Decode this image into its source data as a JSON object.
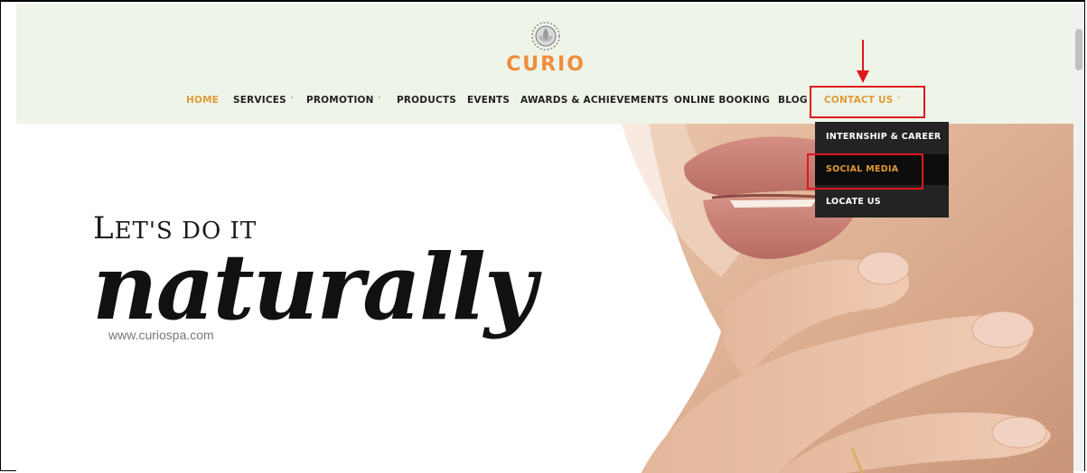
{
  "site": {
    "brand": "CURIO",
    "nav": [
      {
        "label": "HOME",
        "has_caret": false
      },
      {
        "label": "SERVICES",
        "has_caret": true
      },
      {
        "label": "PROMOTION",
        "has_caret": true
      },
      {
        "label": "PRODUCTS",
        "has_caret": false
      },
      {
        "label": "EVENTS",
        "has_caret": false
      },
      {
        "label": "AWARDS & ACHIEVEMENTS",
        "has_caret": true
      },
      {
        "label": "ONLINE BOOKING",
        "has_caret": false
      },
      {
        "label": "BLOG",
        "has_caret": false
      },
      {
        "label": "CONTACT US",
        "has_caret": true
      }
    ],
    "caret_glyph": "˅",
    "active_nav": "HOME",
    "dropdown": {
      "parent": "CONTACT US",
      "items": [
        "INTERNSHIP & CAREER",
        "SOCIAL MEDIA",
        "LOCATE US"
      ],
      "highlighted": "SOCIAL MEDIA"
    }
  },
  "hero": {
    "tagline_first": "L",
    "tagline_rest": "ET'S DO IT",
    "script_word": "naturally",
    "url": "www.curiospa.com"
  },
  "colors": {
    "header_bg": "#eef4e8",
    "accent": "#e19a35",
    "brand": "#f08c3c",
    "dropdown_bg": "#232323",
    "annotation": "#e0161e"
  },
  "icons": [
    "lotus-logo-icon",
    "down-arrow-annotation-icon",
    "chevron-down-icon"
  ]
}
